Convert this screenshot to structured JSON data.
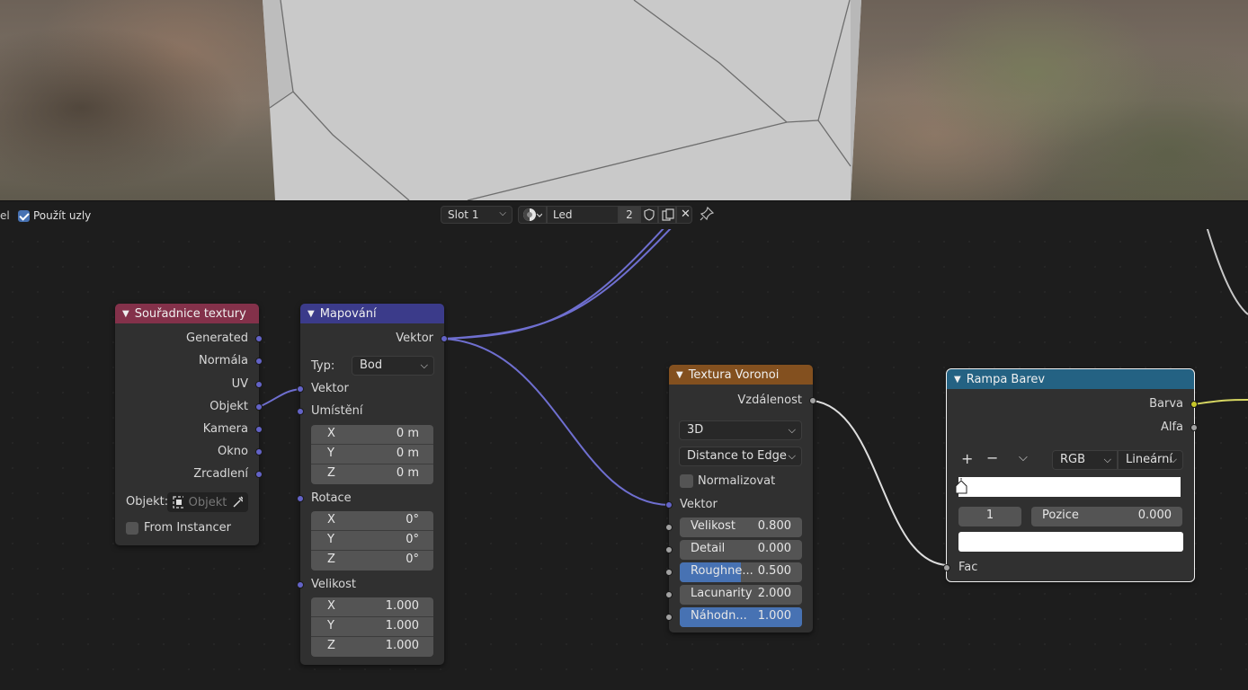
{
  "header": {
    "edge_label": "el",
    "use_nodes_label": "Použít uzly",
    "slot": "Slot 1",
    "material_name": "Led",
    "user_count": "2"
  },
  "nodes": {
    "texcoord": {
      "title": "Souřadnice textury",
      "outputs": [
        "Generated",
        "Normála",
        "UV",
        "Objekt",
        "Kamera",
        "Okno",
        "Zrcadlení"
      ],
      "object_label": "Objekt:",
      "object_placeholder": "Objekt",
      "from_instancer": "From Instancer",
      "header_color": "#83314a"
    },
    "mapping": {
      "title": "Mapování",
      "output": "Vektor",
      "type_label": "Typ:",
      "type_value": "Bod",
      "input_vector": "Vektor",
      "location_label": "Umístění",
      "location": [
        {
          "axis": "X",
          "value": "0 m"
        },
        {
          "axis": "Y",
          "value": "0 m"
        },
        {
          "axis": "Z",
          "value": "0 m"
        }
      ],
      "rotation_label": "Rotace",
      "rotation": [
        {
          "axis": "X",
          "value": "0°"
        },
        {
          "axis": "Y",
          "value": "0°"
        },
        {
          "axis": "Z",
          "value": "0°"
        }
      ],
      "scale_label": "Velikost",
      "scale": [
        {
          "axis": "X",
          "value": "1.000"
        },
        {
          "axis": "Y",
          "value": "1.000"
        },
        {
          "axis": "Z",
          "value": "1.000"
        }
      ],
      "header_color": "#3b3b8a"
    },
    "voronoi": {
      "title": "Textura Voronoi",
      "output": "Vzdálenost",
      "dimension": "3D",
      "feature": "Distance to Edge",
      "normalize": "Normalizovat",
      "input_vector": "Vektor",
      "params": [
        {
          "label": "Velikost",
          "value": "0.800",
          "fill": 0
        },
        {
          "label": "Detail",
          "value": "0.000",
          "fill": 0
        },
        {
          "label": "Roughne...",
          "value": "0.500",
          "fill": 0.5
        },
        {
          "label": "Lacunarity",
          "value": "2.000",
          "fill": 0
        },
        {
          "label": "Náhodn...",
          "value": "1.000",
          "fill": 1
        }
      ],
      "header_color": "#83501f"
    },
    "ramp": {
      "title": "Rampa Barev",
      "outputs": [
        "Barva",
        "Alfa"
      ],
      "color_mode": "RGB",
      "interpolation": "Lineární",
      "stop_index": "1",
      "position_label": "Pozice",
      "position_value": "0.000",
      "input_fac": "Fac",
      "header_color": "#246283"
    }
  },
  "icons": [
    "checkbox-icon",
    "material-sphere-icon",
    "shield-icon",
    "duplicate-icon",
    "close-icon",
    "pin-icon",
    "plus-icon",
    "minus-icon",
    "chevron-down-icon",
    "eyedropper-icon",
    "object-icon"
  ]
}
